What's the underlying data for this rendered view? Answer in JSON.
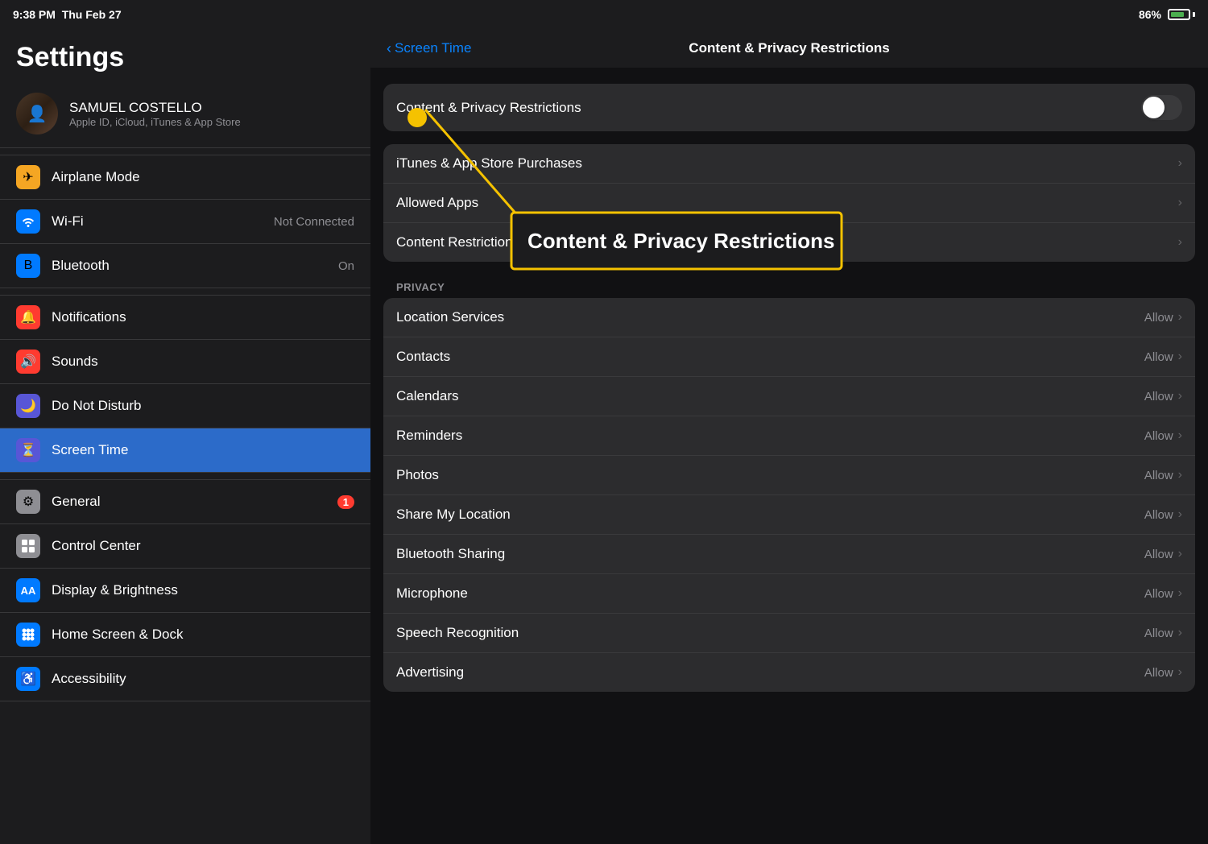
{
  "statusBar": {
    "time": "9:38 PM",
    "date": "Thu Feb 27",
    "battery": "86%"
  },
  "sidebar": {
    "title": "Settings",
    "user": {
      "name": "SAMUEL COSTELLO",
      "subtitle": "Apple ID, iCloud, iTunes & App Store"
    },
    "topItems": [
      {
        "id": "airplane-mode",
        "label": "Airplane Mode",
        "icon": "✈",
        "iconBg": "#f5a623",
        "value": ""
      },
      {
        "id": "wifi",
        "label": "Wi-Fi",
        "icon": "📶",
        "iconBg": "#007aff",
        "value": "Not Connected"
      },
      {
        "id": "bluetooth",
        "label": "Bluetooth",
        "icon": "⟨⟩",
        "iconBg": "#007aff",
        "value": "On"
      }
    ],
    "middleItems": [
      {
        "id": "notifications",
        "label": "Notifications",
        "icon": "🔔",
        "iconBg": "#ff3b30",
        "value": ""
      },
      {
        "id": "sounds",
        "label": "Sounds",
        "icon": "🔊",
        "iconBg": "#ff3b30",
        "value": ""
      },
      {
        "id": "do-not-disturb",
        "label": "Do Not Disturb",
        "icon": "🌙",
        "iconBg": "#5856d6",
        "value": ""
      },
      {
        "id": "screen-time",
        "label": "Screen Time",
        "icon": "⏳",
        "iconBg": "#5856d6",
        "value": "",
        "active": true
      }
    ],
    "bottomItems": [
      {
        "id": "general",
        "label": "General",
        "icon": "⚙",
        "iconBg": "#8e8e93",
        "value": "",
        "badge": "1"
      },
      {
        "id": "control-center",
        "label": "Control Center",
        "icon": "⊞",
        "iconBg": "#8e8e93",
        "value": ""
      },
      {
        "id": "display-brightness",
        "label": "Display & Brightness",
        "icon": "AA",
        "iconBg": "#007aff",
        "value": ""
      },
      {
        "id": "home-screen-dock",
        "label": "Home Screen & Dock",
        "icon": "⊞",
        "iconBg": "#007aff",
        "value": ""
      },
      {
        "id": "accessibility",
        "label": "Accessibility",
        "icon": "♿",
        "iconBg": "#007aff",
        "value": ""
      }
    ]
  },
  "rightPanel": {
    "backLabel": "Screen Time",
    "title": "Content & Privacy Restrictions",
    "toggleLabel": "Content & Privacy Restrictions",
    "toggleOn": false,
    "topGroup": [
      {
        "label": "iTunes & App Store Purchases",
        "value": ""
      },
      {
        "label": "Allowed Apps",
        "value": ""
      },
      {
        "label": "Content Restrictions",
        "value": ""
      }
    ],
    "privacySection": {
      "header": "PRIVACY",
      "items": [
        {
          "label": "Location Services",
          "value": "Allow"
        },
        {
          "label": "Contacts",
          "value": "Allow"
        },
        {
          "label": "Calendars",
          "value": "Allow"
        },
        {
          "label": "Reminders",
          "value": "Allow"
        },
        {
          "label": "Photos",
          "value": "Allow"
        },
        {
          "label": "Share My Location",
          "value": "Allow"
        },
        {
          "label": "Bluetooth Sharing",
          "value": "Allow"
        },
        {
          "label": "Microphone",
          "value": "Allow"
        },
        {
          "label": "Speech Recognition",
          "value": "Allow"
        },
        {
          "label": "Advertising",
          "value": "Allow"
        }
      ]
    }
  },
  "annotation": {
    "boxLabel": "Content & Privacy Restrictions"
  }
}
